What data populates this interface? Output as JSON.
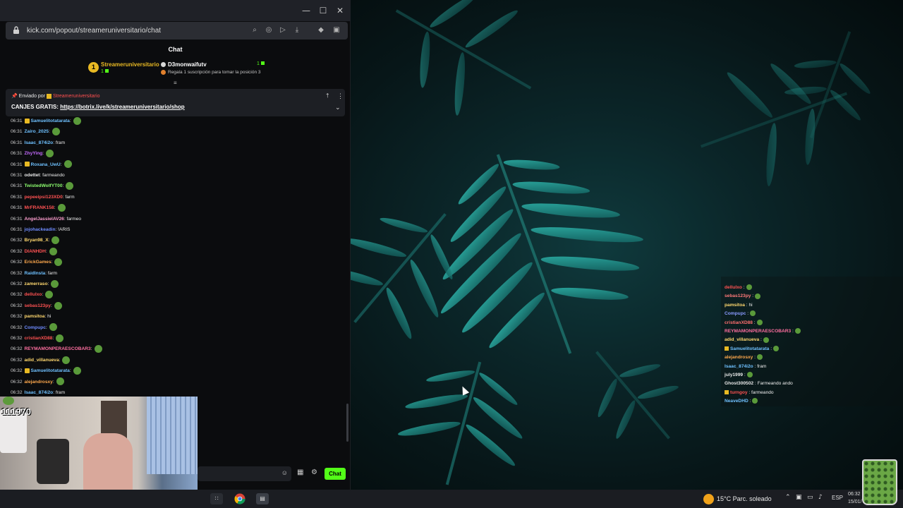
{
  "browser": {
    "url": "kick.com/popout/streameruniversitario/chat",
    "window_controls": {
      "minimize": "—",
      "maximize": "☐",
      "close": "✕"
    }
  },
  "chat": {
    "header": "Chat",
    "leaderboard": {
      "rank": "1",
      "first": {
        "name": "Streameruniversitario",
        "count": "1"
      },
      "second": {
        "name": "D3monwaifutv",
        "count": "1",
        "sub": "Regala 1 suscripción para tomar la posición 3"
      }
    },
    "pinned": {
      "sent_by": "Enviado por",
      "sender": "Streameruniversitario",
      "text_prefix": "CANJES GRATIS:",
      "link": "https://botrix.live/k/streameruniversitario/shop"
    },
    "messages": [
      {
        "time": "06:31",
        "user": "Samuelitotatarata",
        "color": "#6fc1ff",
        "text": ":",
        "emote": true,
        "badge": true
      },
      {
        "time": "06:31",
        "user": "Zairo_2025",
        "color": "#6fc1ff",
        "text": ":",
        "emote": true
      },
      {
        "time": "06:31",
        "user": "Isaac_874i2o",
        "color": "#6fc1ff",
        "text": ": fram"
      },
      {
        "time": "06:31",
        "user": "ZhyYing",
        "color": "#c56bff",
        "text": ":",
        "emote": true
      },
      {
        "time": "06:31",
        "user": "Roxana_UwU",
        "color": "#6fc1ff",
        "text": ":",
        "emote": true,
        "badge": true
      },
      {
        "time": "06:31",
        "user": "odettet",
        "color": "#e8e8e8",
        "text": ": farmeando"
      },
      {
        "time": "06:31",
        "user": "TwistedWolfYT00",
        "color": "#8dff6f",
        "text": ":",
        "emote": true
      },
      {
        "time": "06:31",
        "user": "pepeeipsi123XD0",
        "color": "#ff5252",
        "text": ": farm"
      },
      {
        "time": "06:31",
        "user": "MrFRANK158",
        "color": "#ff5252",
        "text": ":",
        "emote": true
      },
      {
        "time": "06:31",
        "user": "AngelJassielAV26",
        "color": "#ff9fd0",
        "text": ": farmeo"
      },
      {
        "time": "06:31",
        "user": "jojohackeadin",
        "color": "#6f8cff",
        "text": ": !ARIS"
      },
      {
        "time": "06:32",
        "user": "Bryan98_X",
        "color": "#ffd86f",
        "text": ":",
        "emote": true
      },
      {
        "time": "06:32",
        "user": "DIANHDH",
        "color": "#ff5252",
        "text": ":",
        "emote": true
      },
      {
        "time": "06:32",
        "user": "ErickGames",
        "color": "#ffa94d",
        "text": ":",
        "emote": true
      },
      {
        "time": "06:32",
        "user": "RaidInsta",
        "color": "#6fc1ff",
        "text": ": farm"
      },
      {
        "time": "06:32",
        "user": "zamerraso",
        "color": "#ffd86f",
        "text": ":",
        "emote": true
      },
      {
        "time": "06:32",
        "user": "dellulxo",
        "color": "#ff5252",
        "text": ":",
        "emote": true
      },
      {
        "time": "06:32",
        "user": "sebas123py",
        "color": "#ff5252",
        "text": ":",
        "emote": true
      },
      {
        "time": "06:32",
        "user": "pamsitoa",
        "color": "#ffd86f",
        "text": ": hi"
      },
      {
        "time": "06:32",
        "user": "Compupc",
        "color": "#6f8cff",
        "text": ":",
        "emote": true
      },
      {
        "time": "06:32",
        "user": "cristianXD88",
        "color": "#ff5252",
        "text": ":",
        "emote": true
      },
      {
        "time": "06:32",
        "user": "REYMAMONPERAESCOBAR3",
        "color": "#ff6fa0",
        "text": ":",
        "emote": true
      },
      {
        "time": "06:32",
        "user": "adid_villanueva",
        "color": "#ffd86f",
        "text": ":",
        "emote": true
      },
      {
        "time": "06:32",
        "user": "Samuelitotatarata",
        "color": "#6fc1ff",
        "text": ":",
        "emote": true,
        "badge": true
      },
      {
        "time": "06:32",
        "user": "alejandrosxy",
        "color": "#ffa94d",
        "text": ":",
        "emote": true
      },
      {
        "time": "06:32",
        "user": "Isaac_874i2o",
        "color": "#6fc1ff",
        "text": ": fram"
      }
    ],
    "send_button": "Chat"
  },
  "webcam": {
    "count": "111970"
  },
  "overlay_chat": [
    {
      "user": "dellulxo",
      "color": "#ff5252",
      "text": ":",
      "emote": true
    },
    {
      "user": "sebas123py",
      "color": "#ff7a7a",
      "text": ":",
      "emote": true
    },
    {
      "user": "pamsitoa",
      "color": "#ffd86f",
      "text": ": hi"
    },
    {
      "user": "Compupc",
      "color": "#8a9bff",
      "text": ":",
      "emote": true
    },
    {
      "user": "cristianXD88",
      "color": "#ff6f6f",
      "text": ":",
      "emote": true
    },
    {
      "user": "REYMAMONPERAESCOBAR3",
      "color": "#ff6fa0",
      "text": ":",
      "emote": true
    },
    {
      "user": "adid_villanueva",
      "color": "#ffd86f",
      "text": ":",
      "emote": true
    },
    {
      "user": "Samuelitotatarata",
      "color": "#6fc1ff",
      "text": ":",
      "emote": true,
      "badge": true
    },
    {
      "user": "alejandrosxy",
      "color": "#ffa94d",
      "text": ":",
      "emote": true
    },
    {
      "user": "Isaac_874i2o",
      "color": "#6fc1ff",
      "text": ": fram"
    },
    {
      "user": "july1999",
      "color": "#e8e8e8",
      "text": ":",
      "emote": true
    },
    {
      "user": "Ghost300502",
      "color": "#e8e8e8",
      "text": ": Farmeando ando"
    },
    {
      "user": "turngoy",
      "color": "#ff5252",
      "text": ": farmeando",
      "badge": true
    },
    {
      "user": "NeaveDHD",
      "color": "#6fc1ff",
      "text": ":",
      "emote": true
    }
  ],
  "taskbar": {
    "weather": "15°C  Parc. soleado",
    "language": "ESP",
    "time": "06:32",
    "date": "15/01/"
  },
  "colors": {
    "kick_green": "#53fc18",
    "gold": "#e8b923"
  }
}
